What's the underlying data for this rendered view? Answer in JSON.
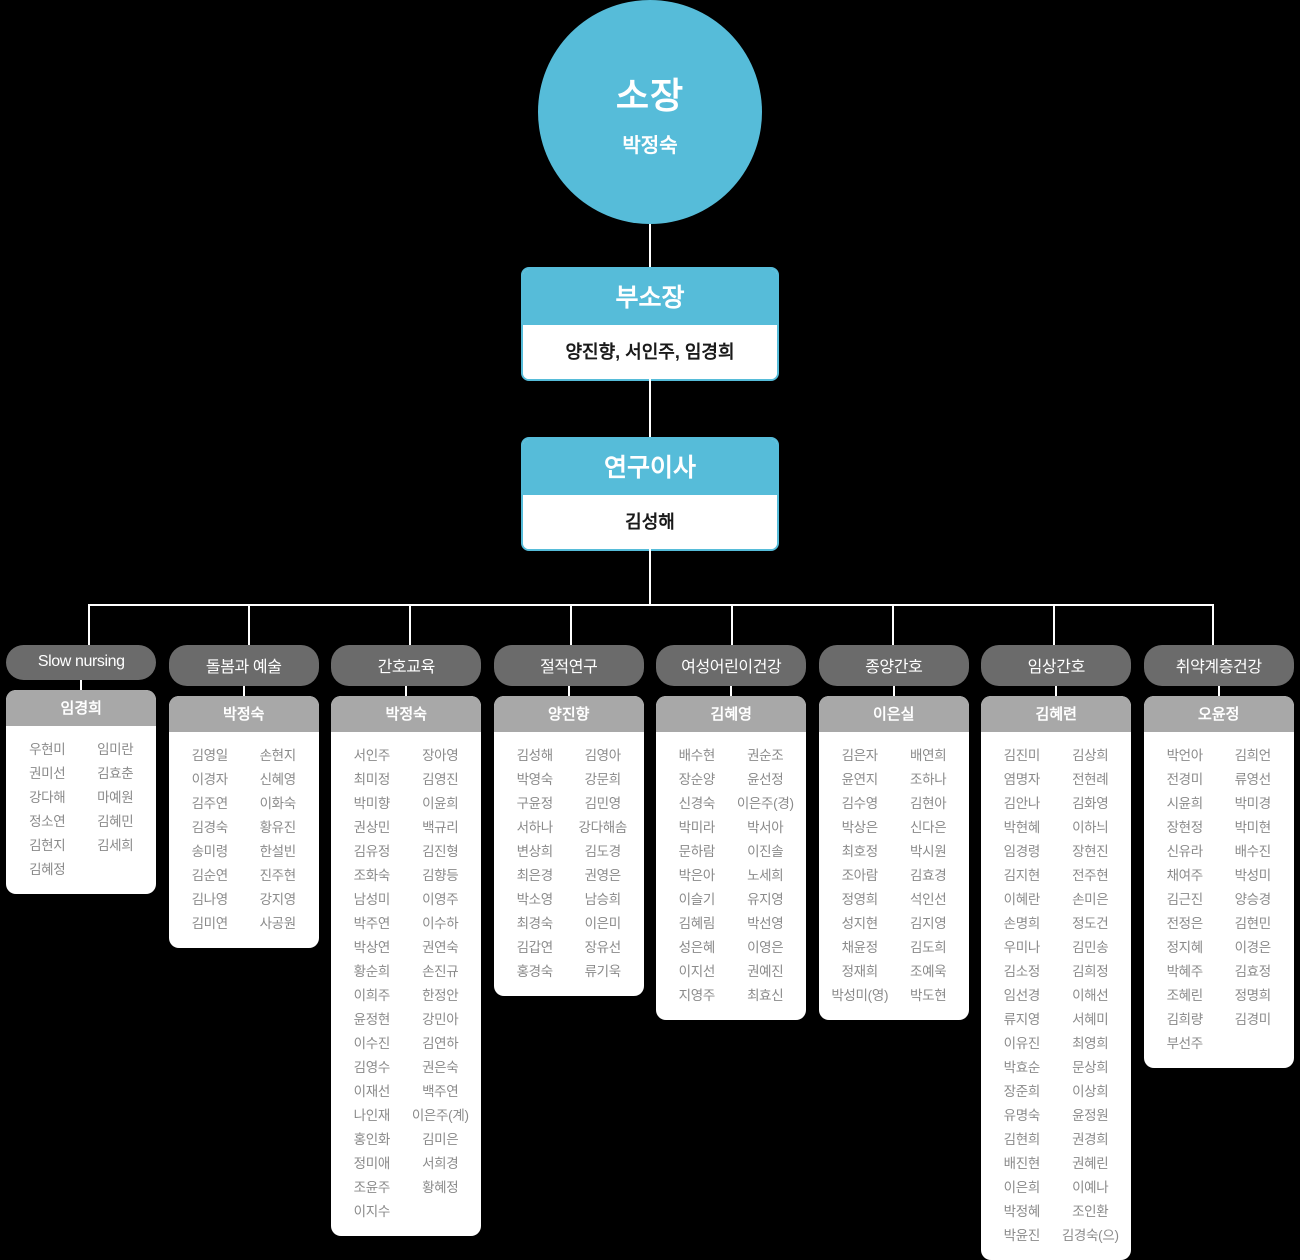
{
  "org": {
    "director": {
      "title": "소장",
      "name": "박정숙"
    },
    "vice_director": {
      "title": "부소장",
      "name": "양진향, 서인주, 임경희"
    },
    "research_director": {
      "title": "연구이사",
      "name": "김성해"
    }
  },
  "colors": {
    "accent": "#56bcd9",
    "dept_header": "#6b6b6b",
    "dept_lead": "#a8a8a8",
    "background": "#000000",
    "card": "#ffffff",
    "member_text": "#8a8a8a"
  },
  "departments": [
    {
      "name": "Slow nursing",
      "lead": "임경희",
      "members_left": [
        "우현미",
        "권미선",
        "강다해",
        "정소연",
        "김현지",
        "김혜정"
      ],
      "members_right": [
        "임미란",
        "김효춘",
        "마예원",
        "김혜민",
        "김세희"
      ]
    },
    {
      "name": "돌봄과 예술",
      "lead": "박정숙",
      "members_left": [
        "김영일",
        "이경자",
        "김주연",
        "김경숙",
        "송미령",
        "김순연",
        "김나영",
        "김미연"
      ],
      "members_right": [
        "손현지",
        "신혜영",
        "이화숙",
        "황유진",
        "한설빈",
        "진주현",
        "강지영",
        "사공원"
      ]
    },
    {
      "name": "간호교육",
      "lead": "박정숙",
      "members_left": [
        "서인주",
        "최미정",
        "박미향",
        "권상민",
        "김유정",
        "조화숙",
        "남성미",
        "박주연",
        "박상연",
        "황순희",
        "이희주",
        "윤정현",
        "이수진",
        "김영수",
        "이재선",
        "나인재",
        "홍인화",
        "정미애",
        "조윤주",
        "이지수"
      ],
      "members_right": [
        "장아영",
        "김영진",
        "이윤희",
        "백규리",
        "김진형",
        "김향등",
        "이영주",
        "이수하",
        "권연숙",
        "손진규",
        "한정안",
        "강민아",
        "김연하",
        "권은숙",
        "백주연",
        "이은주(계)",
        "김미은",
        "서희경",
        "황혜정"
      ]
    },
    {
      "name": "절적연구",
      "lead": "양진향",
      "members_left": [
        "김성해",
        "박영숙",
        "구윤정",
        "서하나",
        "변상희",
        "최은경",
        "박소영",
        "최경숙",
        "김갑연",
        "홍경숙"
      ],
      "members_right": [
        "김영아",
        "강문희",
        "김민영",
        "강다해솜",
        "김도경",
        "권영은",
        "남승희",
        "이은미",
        "장유선",
        "류기욱"
      ]
    },
    {
      "name": "여성어린이건강",
      "lead": "김혜영",
      "members_left": [
        "배수현",
        "장순양",
        "신경숙",
        "박미라",
        "문하람",
        "박은아",
        "이슬기",
        "김혜림",
        "성은혜",
        "이지선",
        "지영주"
      ],
      "members_right": [
        "권순조",
        "윤선정",
        "이은주(경)",
        "박서아",
        "이진솔",
        "노세희",
        "유지영",
        "박선영",
        "이영은",
        "권예진",
        "최효신"
      ]
    },
    {
      "name": "종양간호",
      "lead": "이은실",
      "members_left": [
        "김은자",
        "윤연지",
        "김수영",
        "박상은",
        "최호정",
        "조아람",
        "정영희",
        "성지현",
        "채윤정",
        "정재희",
        "박성미(영)"
      ],
      "members_right": [
        "배연희",
        "조하나",
        "김현아",
        "신다은",
        "박시원",
        "김효경",
        "석인선",
        "김지영",
        "김도희",
        "조예욱",
        "박도현"
      ]
    },
    {
      "name": "임상간호",
      "lead": "김혜련",
      "members_left": [
        "김진미",
        "염명자",
        "김안나",
        "박현혜",
        "임경령",
        "김지현",
        "이혜란",
        "손명희",
        "우미나",
        "김소정",
        "임선경",
        "류지영",
        "이유진",
        "박효순",
        "장준희",
        "유명숙",
        "김현희",
        "배진현",
        "이은희",
        "박정혜",
        "박윤진"
      ],
      "members_right": [
        "김상희",
        "전현례",
        "김화영",
        "이하늬",
        "장현진",
        "전주현",
        "손미은",
        "정도건",
        "김민송",
        "김희정",
        "이해선",
        "서혜미",
        "최영희",
        "문상희",
        "이상희",
        "윤정원",
        "권경희",
        "권혜린",
        "이예나",
        "조인환",
        "김경숙(으)"
      ]
    },
    {
      "name": "취약계층건강",
      "lead": "오윤정",
      "members_left": [
        "박언아",
        "전경미",
        "시윤희",
        "장현정",
        "신유라",
        "채여주",
        "김근진",
        "전정은",
        "정지혜",
        "박혜주",
        "조혜린",
        "김희량",
        "부선주"
      ],
      "members_right": [
        "김희언",
        "류영선",
        "박미경",
        "박미현",
        "배수진",
        "박성미",
        "양승경",
        "김현민",
        "이경은",
        "김효정",
        "정명희",
        "김경미"
      ]
    }
  ]
}
